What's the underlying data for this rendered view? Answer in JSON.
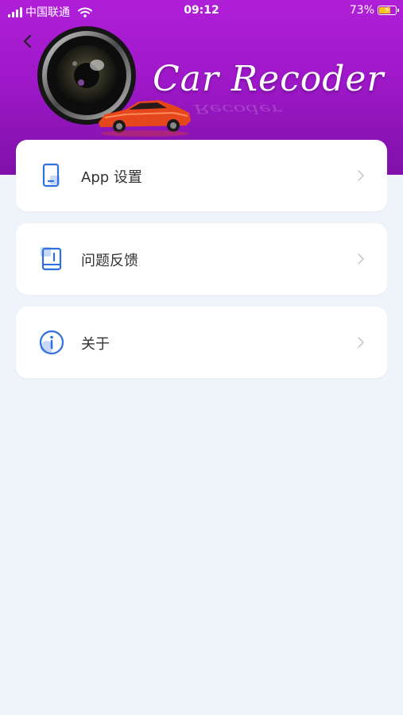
{
  "status_bar": {
    "carrier": "中国联通",
    "time": "09:12",
    "battery": "73%",
    "battery_level": 0.73,
    "wifi_icon": "wifi-icon",
    "signal_icon": "cellular-signal-icon"
  },
  "header": {
    "back_icon": "chevron-left-icon",
    "brand_text": "Car Recoder",
    "background_colors": [
      "#b01fd8",
      "#7f10a8"
    ]
  },
  "menu": {
    "items": [
      {
        "label": "App 设置",
        "icon": "phone-settings-icon",
        "chevron": "chevron-right-icon"
      },
      {
        "label": "问题反馈",
        "icon": "feedback-icon",
        "chevron": "chevron-right-icon"
      },
      {
        "label": "关于",
        "icon": "info-icon",
        "chevron": "chevron-right-icon"
      }
    ]
  },
  "colors": {
    "accent": "#2f6fe0",
    "page_background": "#eff3fa",
    "card_background": "#ffffff",
    "text": "#333333"
  }
}
